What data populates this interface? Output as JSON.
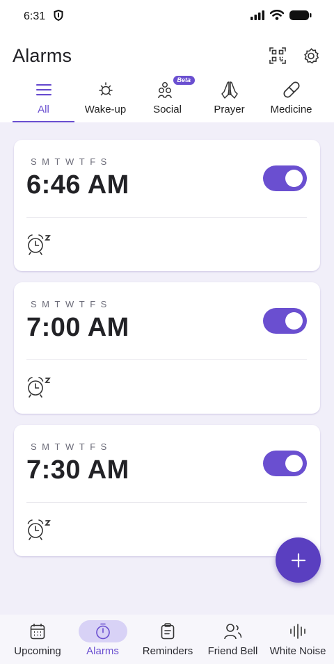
{
  "status_bar": {
    "time": "6:31",
    "icons": [
      "shield-icon",
      "signal-icon",
      "wifi-icon",
      "battery-icon"
    ]
  },
  "header": {
    "title": "Alarms",
    "actions": [
      "qr-code-icon",
      "gear-icon"
    ]
  },
  "tabs": [
    {
      "label": "All",
      "icon": "menu-icon",
      "active": true
    },
    {
      "label": "Wake-up",
      "icon": "sun-icon",
      "active": false
    },
    {
      "label": "Social",
      "icon": "people-icon",
      "active": false,
      "badge": "Beta"
    },
    {
      "label": "Prayer",
      "icon": "praying-hands-icon",
      "active": false
    },
    {
      "label": "Medicine",
      "icon": "pill-icon",
      "active": false
    }
  ],
  "alarms": [
    {
      "days": [
        "S",
        "M",
        "T",
        "W",
        "T",
        "F",
        "S"
      ],
      "time": "6:46 AM",
      "enabled": true
    },
    {
      "days": [
        "S",
        "M",
        "T",
        "W",
        "T",
        "F",
        "S"
      ],
      "time": "7:00 AM",
      "enabled": true
    },
    {
      "days": [
        "S",
        "M",
        "T",
        "W",
        "T",
        "F",
        "S"
      ],
      "time": "7:30 AM",
      "enabled": true
    }
  ],
  "fab": {
    "icon": "plus-icon"
  },
  "bottom_nav": [
    {
      "label": "Upcoming",
      "icon": "calendar-icon",
      "active": false
    },
    {
      "label": "Alarms",
      "icon": "timer-icon",
      "active": true
    },
    {
      "label": "Reminders",
      "icon": "clipboard-icon",
      "active": false
    },
    {
      "label": "Friend Bell",
      "icon": "friends-icon",
      "active": false
    },
    {
      "label": "White Noise",
      "icon": "sound-wave-icon",
      "active": false
    }
  ],
  "colors": {
    "accent": "#6a4fd0",
    "fab": "#5a3fc0",
    "list_background": "#f1eff9",
    "nav_active_pill": "#d8d2f6"
  }
}
